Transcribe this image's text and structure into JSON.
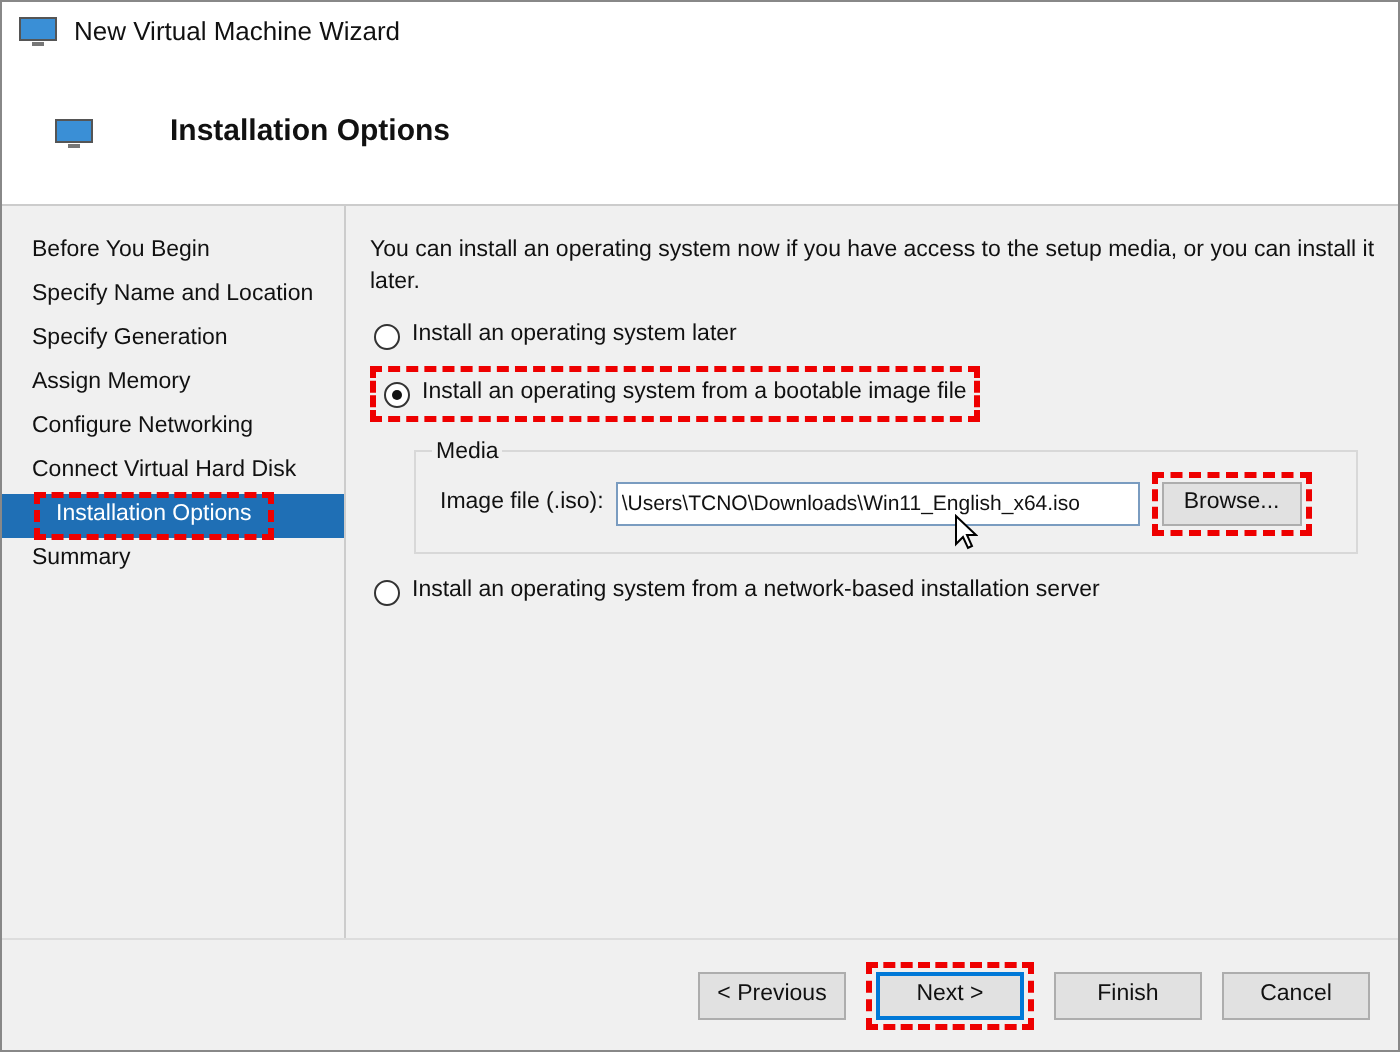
{
  "window": {
    "title": "New Virtual Machine Wizard"
  },
  "header": {
    "title": "Installation Options"
  },
  "sidebar": {
    "items": [
      {
        "label": "Before You Begin",
        "selected": false,
        "highlighted": false
      },
      {
        "label": "Specify Name and Location",
        "selected": false,
        "highlighted": false
      },
      {
        "label": "Specify Generation",
        "selected": false,
        "highlighted": false
      },
      {
        "label": "Assign Memory",
        "selected": false,
        "highlighted": false
      },
      {
        "label": "Configure Networking",
        "selected": false,
        "highlighted": false
      },
      {
        "label": "Connect Virtual Hard Disk",
        "selected": false,
        "highlighted": false
      },
      {
        "label": "Installation Options",
        "selected": true,
        "highlighted": true
      },
      {
        "label": "Summary",
        "selected": false,
        "highlighted": false
      }
    ]
  },
  "content": {
    "intro": "You can install an operating system now if you have access to the setup media, or you can install it later.",
    "options": [
      {
        "label": "Install an operating system later",
        "selected": false,
        "highlighted": false
      },
      {
        "label": "Install an operating system from a bootable image file",
        "selected": true,
        "highlighted": true,
        "media": {
          "title": "Media",
          "field_label": "Image file (.iso):",
          "value": "\\Users\\TCNO\\Downloads\\Win11_English_x64.iso",
          "browse": {
            "label": "Browse...",
            "highlighted": true
          }
        }
      },
      {
        "label": "Install an operating system from a network-based installation server",
        "selected": false,
        "highlighted": false
      }
    ]
  },
  "buttons": [
    {
      "label": "< Previous",
      "highlighted": false,
      "default": false
    },
    {
      "label": "Next >",
      "highlighted": true,
      "default": true
    },
    {
      "label": "Finish",
      "highlighted": false,
      "default": false
    },
    {
      "label": "Cancel",
      "highlighted": false,
      "default": false
    }
  ]
}
